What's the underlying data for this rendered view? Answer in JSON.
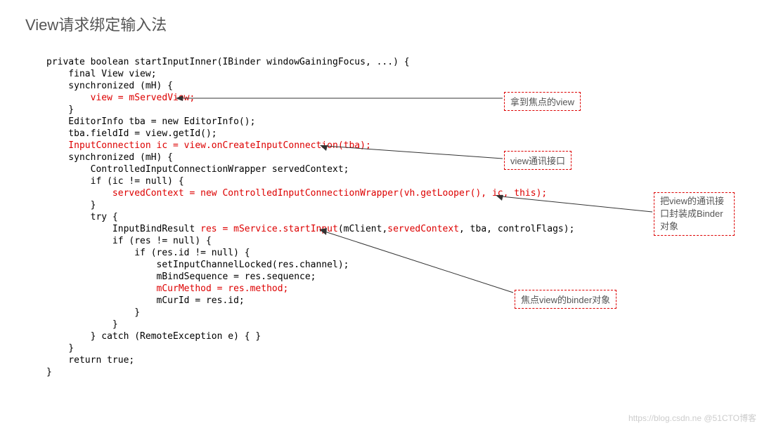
{
  "title": "View请求绑定输入法",
  "code": {
    "l1": "private boolean startInputInner(IBinder windowGainingFocus, ...) {",
    "l2": "    final View view;",
    "l3": "    synchronized (mH) {",
    "l4a": "        ",
    "l4b": "view = mServedView;",
    "l5": "    }",
    "l6": "    EditorInfo tba = new EditorInfo();",
    "l7": "    tba.fieldId = view.getId();",
    "l8": "    InputConnection ic = view.onCreateInputConnection(tba);",
    "l9": "    synchronized (mH) {",
    "l10": "        ControlledInputConnectionWrapper servedContext;",
    "l11": "        if (ic != null) {",
    "l12a": "            ",
    "l12b": "servedContext = new ControlledInputConnectionWrapper(vh.getLooper(), ic, this);",
    "l13": "        }",
    "l14": "        try {",
    "l15a": "            InputBindResult ",
    "l15b": "res = mService.startInput",
    "l15c": "(mClient,",
    "l15d": "servedContext",
    "l15e": ", tba, controlFlags);",
    "l16": "            if (res != null) {",
    "l17": "                if (res.id != null) {",
    "l18": "                    setInputChannelLocked(res.channel);",
    "l19": "                    mBindSequence = res.sequence;",
    "l20": "                    mCurMethod = res.method;",
    "l21": "                    mCurId = res.id;",
    "l22": "                }",
    "l23": "            }",
    "l24": "        } catch (RemoteException e) { }",
    "l25": "    }",
    "l26": "    return true;",
    "l27": "}"
  },
  "annotations": {
    "a1": "拿到焦点的view",
    "a2": "view通讯接口",
    "a3": "把view的通讯接口封装成Binder对象",
    "a4": "焦点view的binder对象"
  },
  "watermark": "https://blog.csdn.ne  @51CTO博客"
}
